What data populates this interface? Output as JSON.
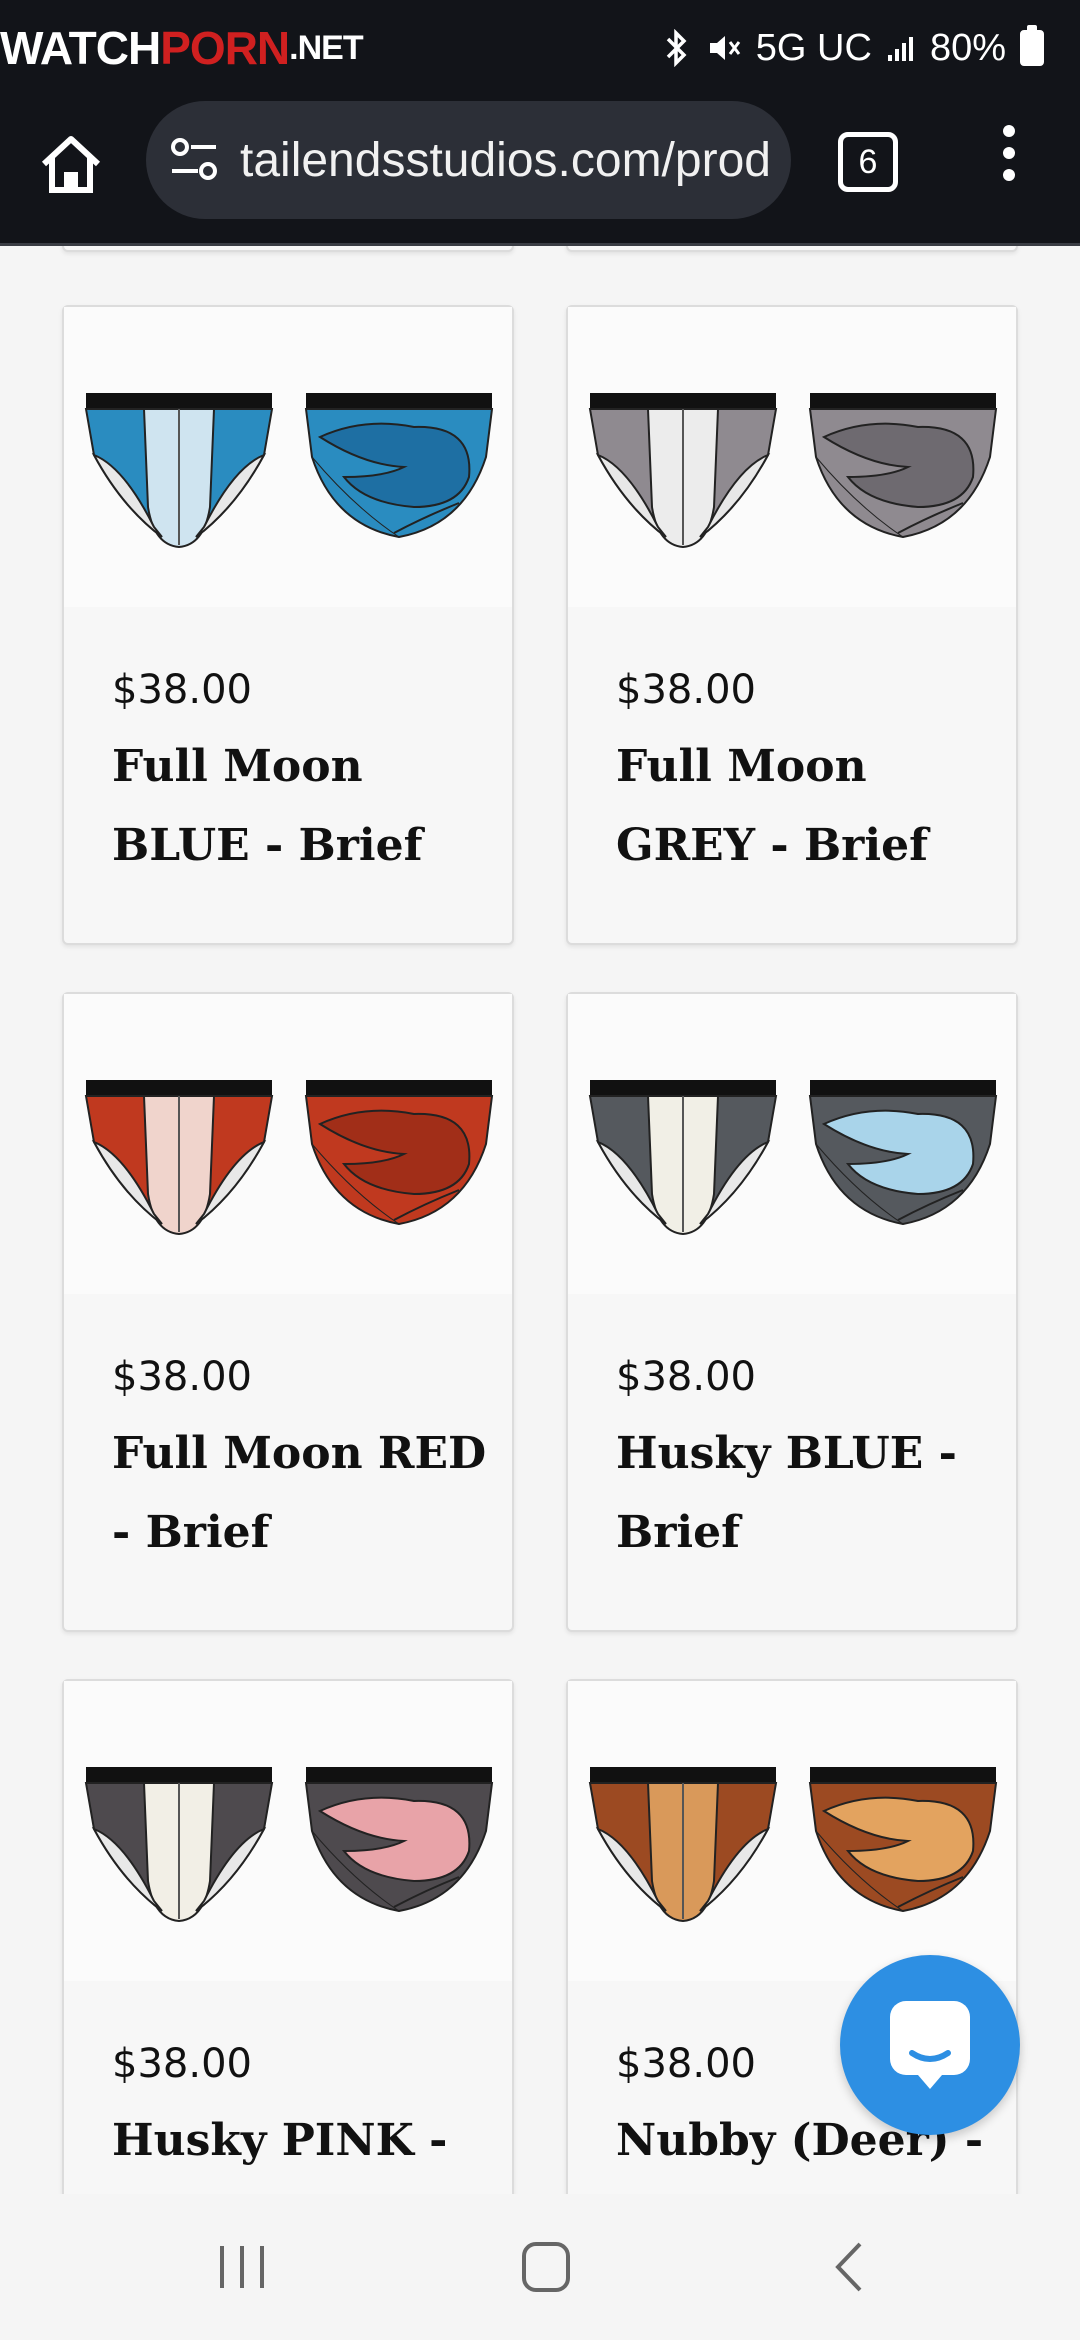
{
  "status_bar": {
    "watermark": {
      "part1": "WATCH",
      "part2": "PORN",
      "part3": ".NET"
    },
    "network": "5G UC",
    "battery": "80%"
  },
  "browser": {
    "url": "tailendsstudios.com/products",
    "tab_count": "6"
  },
  "products": [
    {
      "price": "$38.00",
      "name": "Full Moon BLUE - Brief",
      "colors": {
        "base": "#2a8cc0",
        "light": "#cfe4f0",
        "tail": "#1e6fa3"
      }
    },
    {
      "price": "$38.00",
      "name": "Full Moon GREY - Brief",
      "colors": {
        "base": "#8f8a90",
        "light": "#ececec",
        "tail": "#6e6a70"
      }
    },
    {
      "price": "$38.00",
      "name": "Full Moon RED - Brief",
      "colors": {
        "base": "#c0391f",
        "light": "#f0d4cc",
        "tail": "#a12e18"
      }
    },
    {
      "price": "$38.00",
      "name": "Husky BLUE - Brief",
      "colors": {
        "base": "#55595e",
        "light": "#f1efe6",
        "tail": "#a9d4ea"
      }
    },
    {
      "price": "$38.00",
      "name": "Husky PINK - Brief",
      "colors": {
        "base": "#4e4a4e",
        "light": "#f2efe6",
        "tail": "#e8a3a8"
      }
    },
    {
      "price": "$38.00",
      "name": "Nubby (Deer) - Brief",
      "colors": {
        "base": "#9c4a22",
        "light": "#d9995a",
        "tail": "#e3a35f"
      }
    }
  ],
  "colors": {
    "chrome": "#121419",
    "url_bar": "#2c2f37",
    "chat_button": "#2d8fe3"
  },
  "icons": [
    "home-icon",
    "site-settings-icon",
    "tabs-icon",
    "menu-icon",
    "chat-icon",
    "recent-apps-icon",
    "home-nav-icon",
    "back-icon"
  ]
}
